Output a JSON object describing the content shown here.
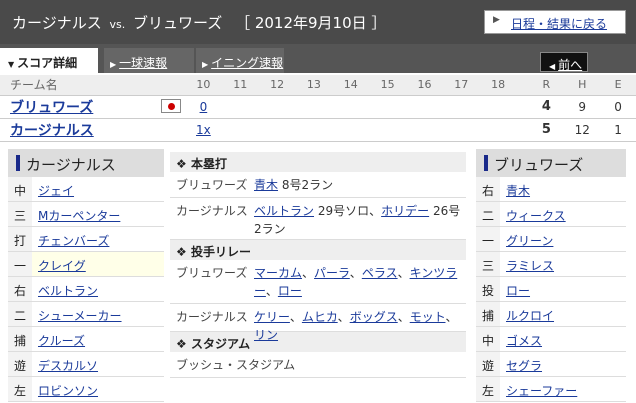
{
  "header": {
    "home_team": "カージナルス",
    "vs": "vs.",
    "away_team": "ブリュワーズ",
    "date": "［ 2012年9月10日 ］",
    "back_link": "日程・結果に戻る"
  },
  "tabs": {
    "score_detail": "スコア詳細",
    "pitch_by_pitch": "一球速報",
    "inning_report": "イニング速報",
    "prev": "前へ"
  },
  "scoreboard": {
    "team_col": "チーム名",
    "innings": [
      "10",
      "11",
      "12",
      "13",
      "14",
      "15",
      "16",
      "17",
      "18"
    ],
    "rhe": [
      "R",
      "H",
      "E"
    ],
    "rows": [
      {
        "team": "ブリュワーズ",
        "scores": [
          "0",
          "",
          "",
          "",
          "",
          "",
          "",
          "",
          ""
        ],
        "R": "4",
        "H": "9",
        "E": "0"
      },
      {
        "team": "カージナルス",
        "scores": [
          "1x",
          "",
          "",
          "",
          "",
          "",
          "",
          "",
          ""
        ],
        "R": "5",
        "H": "12",
        "E": "1"
      }
    ]
  },
  "left_lineup": {
    "team": "カージナルス",
    "players": [
      {
        "pos": "中",
        "name": "ジェイ"
      },
      {
        "pos": "三",
        "name": "Mカーペンター"
      },
      {
        "pos": "打",
        "name": "チェンバーズ"
      },
      {
        "pos": "一",
        "name": "クレイグ"
      },
      {
        "pos": "右",
        "name": "ベルトラン"
      },
      {
        "pos": "二",
        "name": "シューメーカー"
      },
      {
        "pos": "捕",
        "name": "クルーズ"
      },
      {
        "pos": "遊",
        "name": "デスカルソ"
      },
      {
        "pos": "左",
        "name": "ロビンソン"
      }
    ]
  },
  "right_lineup": {
    "team": "ブリュワーズ",
    "players": [
      {
        "pos": "右",
        "name": "青木"
      },
      {
        "pos": "二",
        "name": "ウィークス"
      },
      {
        "pos": "一",
        "name": "グリーン"
      },
      {
        "pos": "三",
        "name": "ラミレス"
      },
      {
        "pos": "投",
        "name": "ロー"
      },
      {
        "pos": "捕",
        "name": "ルクロイ"
      },
      {
        "pos": "中",
        "name": "ゴメス"
      },
      {
        "pos": "遊",
        "name": "セグラ"
      },
      {
        "pos": "左",
        "name": "シェーファー"
      }
    ]
  },
  "homeruns": {
    "title": "本塁打",
    "away_label": "ブリュワーズ",
    "away_player": "青木",
    "away_detail": " 8号2ラン",
    "home_label": "カージナルス",
    "home_player1": "ベルトラン",
    "home_detail1": " 29号ソロ、",
    "home_player2": "ホリデー",
    "home_detail2": " 26号2ラン"
  },
  "relief": {
    "title": "投手リレー",
    "away_label": "ブリュワーズ",
    "away_pitchers": [
      "マーカム",
      "パーラ",
      "ペラス",
      "キンツラー",
      "ロー"
    ],
    "home_label": "カージナルス",
    "home_pitchers": [
      "ケリー",
      "ムヒカ",
      "ボッグス",
      "モット",
      "リン"
    ],
    "sep": "、"
  },
  "stadium": {
    "title": "スタジアム",
    "name": "ブッシュ・スタジアム"
  },
  "colors": {
    "header_bg": "#4a4a4a",
    "link": "#1a3a9a",
    "flag_red": "#cc0000"
  }
}
